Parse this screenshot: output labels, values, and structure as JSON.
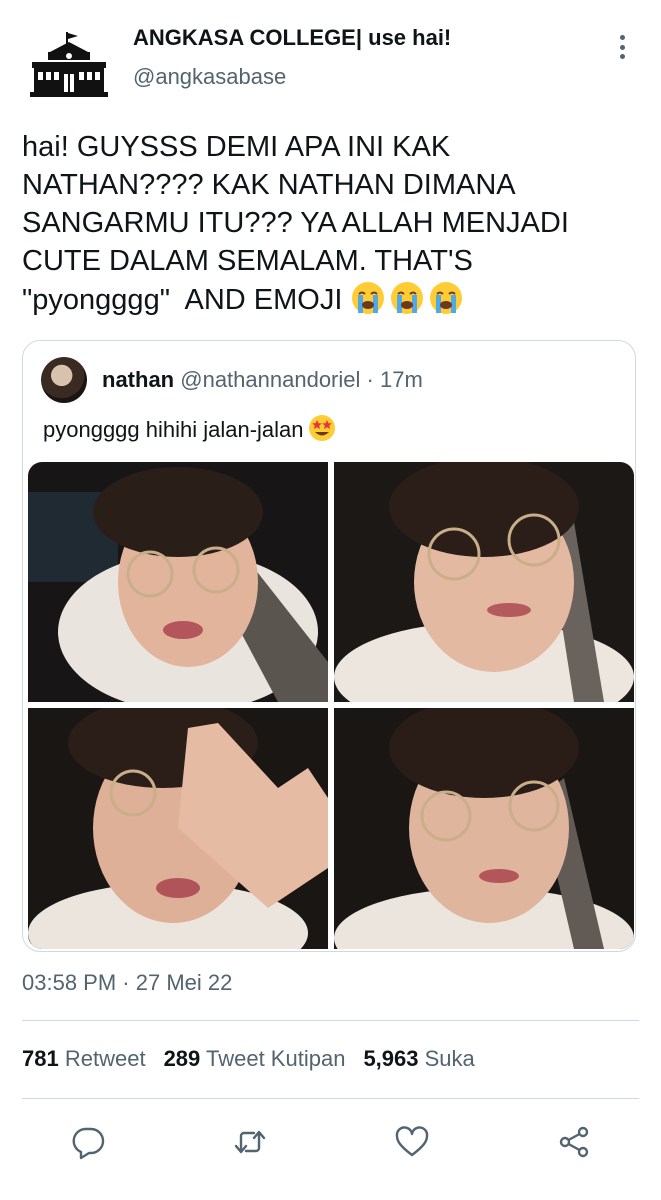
{
  "author": {
    "display_name": "ANGKASA COLLEGE| use hai!",
    "handle": "@angkasabase",
    "avatar_icon": "school-building-icon"
  },
  "tweet": {
    "lines": [
      "hai! GUYSSS DEMI APA INI KAK",
      "NATHAN???? KAK NATHAN DIMANA",
      "SANGARMU ITU??? YA ALLAH MENJADI",
      "CUTE DALAM SEMALAM. THAT'S",
      "\"pyongggg\"  AND EMOJI "
    ],
    "trailing_emoji": "loudly-crying-face-emoji",
    "emoji_count": 3
  },
  "quote": {
    "name": "nathan",
    "handle": "@nathannandoriel",
    "separator": "·",
    "time": "17m",
    "text": "pyongggg hihihi jalan-jalan",
    "emoji": "star-struck-emoji"
  },
  "meta": {
    "time": "03:58 PM",
    "separator": "·",
    "date": "27 Mei 22"
  },
  "stats": {
    "retweets": "781",
    "retweets_label": "Retweet",
    "quotes": "289",
    "quotes_label": "Tweet Kutipan",
    "likes": "5,963",
    "likes_label": "Suka"
  },
  "actions": [
    "reply-icon",
    "retweet-icon",
    "like-icon",
    "share-icon"
  ],
  "colors": {
    "text_primary": "#0f1419",
    "text_secondary": "#536471",
    "border": "#cfd9de"
  }
}
